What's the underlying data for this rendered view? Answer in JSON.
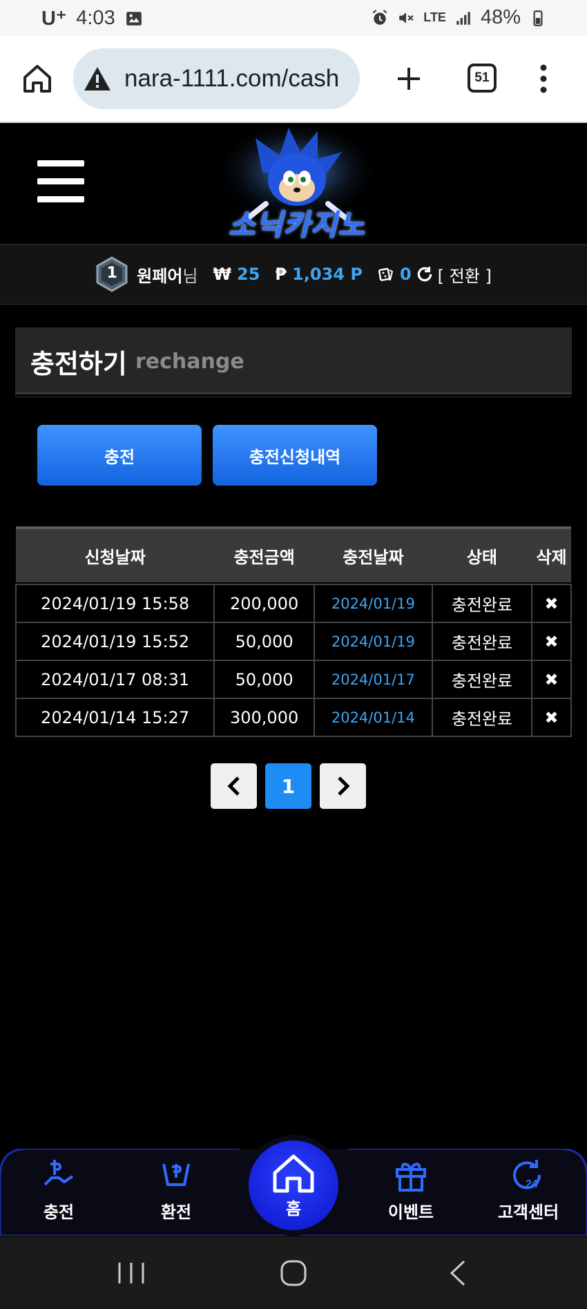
{
  "status_bar": {
    "carrier": "U⁺",
    "time": "4:03",
    "network": "LTE",
    "battery": "48%"
  },
  "browser": {
    "url": "nara-1111.com/cash",
    "tab_count": "51"
  },
  "site": {
    "logo_text": "소닉카지노"
  },
  "user": {
    "level": "1",
    "name": "원페어",
    "honorific": "님",
    "won_symbol": "₩",
    "won_value": "25",
    "point_symbol": "₱",
    "point_value": "1,034 P",
    "chip_value": "0",
    "convert_label": "[ 전환 ]"
  },
  "section": {
    "title": "충전하기",
    "subtitle": "rechange"
  },
  "tabs": {
    "charge_label": "충전",
    "history_label": "충전신청내역"
  },
  "table": {
    "headers": [
      "신청날짜",
      "충전금액",
      "충전날짜",
      "상태",
      "삭제"
    ],
    "rows": [
      {
        "request_date": "2024/01/19 15:58",
        "amount": "200,000",
        "charge_date": "2024/01/19",
        "status": "충전완료",
        "delete": "✖"
      },
      {
        "request_date": "2024/01/19 15:52",
        "amount": "50,000",
        "charge_date": "2024/01/19",
        "status": "충전완료",
        "delete": "✖"
      },
      {
        "request_date": "2024/01/17 08:31",
        "amount": "50,000",
        "charge_date": "2024/01/17",
        "status": "충전완료",
        "delete": "✖"
      },
      {
        "request_date": "2024/01/14 15:27",
        "amount": "300,000",
        "charge_date": "2024/01/14",
        "status": "충전완료",
        "delete": "✖"
      }
    ]
  },
  "pagination": {
    "prev": "‹",
    "current": "1",
    "next": "›"
  },
  "bottom_nav": {
    "charge": "충전",
    "exchange": "환전",
    "home": "홈",
    "event": "이벤트",
    "support": "고객센터"
  },
  "colors": {
    "accent_blue": "#1e8cf5",
    "value_blue": "#3da6f5",
    "nav_blue": "#2a3fff"
  }
}
